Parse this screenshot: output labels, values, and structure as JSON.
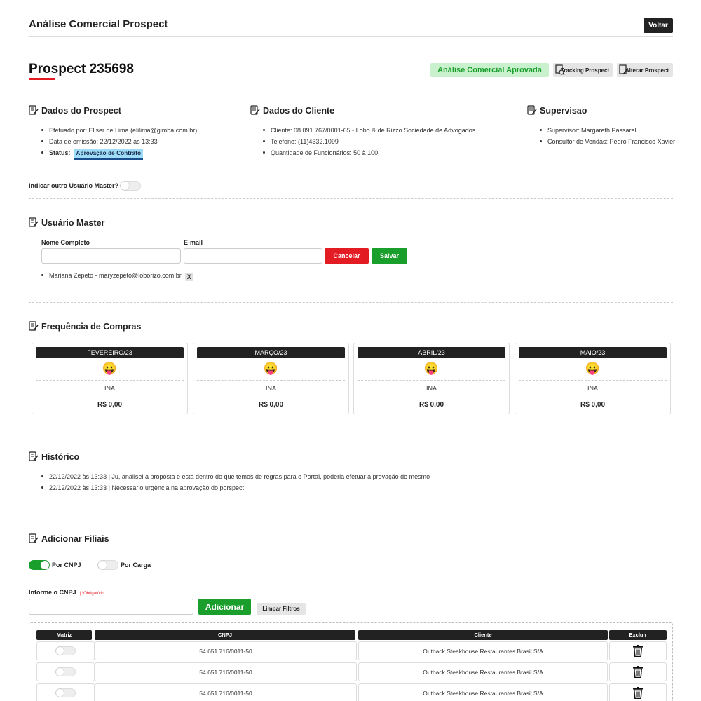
{
  "header": {
    "title": "Análise Comercial Prospect",
    "back_label": "Voltar"
  },
  "prospect": {
    "title": "Prospect 235698",
    "status_badge": "Análise Comercial Aprovada",
    "tracking_label": "Tracking Prospect",
    "alterar_label": "Alterar Prospect"
  },
  "dados_prospect": {
    "heading": "Dados do Prospect",
    "efetuado": "Efetuado por: Eliser de Lima (elilima@gimba.com.br)",
    "emissao": "Data de emissão: 22/12/2022 às 13:33",
    "status_label": "Status:",
    "status_value": "Aprovação de Contrato"
  },
  "dados_cliente": {
    "heading": "Dados do Cliente",
    "cliente": "Cliente: 08.091.767/0001-65 - Lobo & de Rizzo Sociedade de Advogados",
    "telefone": "Telefone: (11)4332.1099",
    "funcionarios": "Quantidade de Funcionários: 50 à 100"
  },
  "supervisao": {
    "heading": "Supervisao",
    "supervisor": "Supervisor: Margareth Passareli",
    "consultor": "Consultor de Vendas: Pedro Francisco Xavier"
  },
  "master_toggle_label": "Indicar outro Usuário Master?",
  "usuario_master": {
    "heading": "Usuário Master",
    "nome_label": "Nome Completo",
    "email_label": "E-mail",
    "nome_value": "",
    "email_value": "",
    "cancel_label": "Cancelar",
    "save_label": "Salvar",
    "entry": "Mariana Zepeto - maryzepeto@loborizo.com.br",
    "remove_label": "X"
  },
  "frequencia": {
    "heading": "Frequência de Compras",
    "months": [
      {
        "name": "FEVEREIRO/23",
        "emoji": "😛",
        "label": "INA",
        "value": "R$ 0,00"
      },
      {
        "name": "MARÇO/23",
        "emoji": "😛",
        "label": "INA",
        "value": "R$ 0,00"
      },
      {
        "name": "ABRIL/23",
        "emoji": "😛",
        "label": "INA",
        "value": "R$ 0,00"
      },
      {
        "name": "MAIO/23",
        "emoji": "😛",
        "label": "INA",
        "value": "R$ 0,00"
      }
    ]
  },
  "historico": {
    "heading": "Histórico",
    "items": [
      "22/12/2022 às 13:33 | Ju, analisei a proposta e esta dentro do que temos de regras para o Portal, poderia efetuar a provação do mesmo",
      "22/12/2022 às 13:33 | Necessário urgência na aprovação do porspect"
    ]
  },
  "filiais": {
    "heading": "Adicionar Filiais",
    "por_cnpj": "Por CNPJ",
    "por_carga": "Por Carga",
    "cnpj_label": "Informe o CNPJ",
    "required": "| *Obrigatório",
    "cnpj_value": "",
    "add_label": "Adicionar",
    "clear_label": "Limpar Filtros",
    "columns": [
      "Matriz",
      "CNPJ",
      "Cliente",
      "Excluir"
    ],
    "rows": [
      {
        "cnpj": "54.651.716/0011-50",
        "cliente": "Outback Steakhouse Restaurantes Brasil S/A"
      },
      {
        "cnpj": "54.651.716/0011-50",
        "cliente": "Outback Steakhouse Restaurantes Brasil S/A"
      },
      {
        "cnpj": "54.651.716/0011-50",
        "cliente": "Outback Steakhouse Restaurantes Brasil S/A"
      }
    ]
  },
  "colors": {
    "accent_red": "#e31b23",
    "green": "#1a9e2c",
    "dark": "#222222",
    "approved_bg": "#c9f1cd"
  }
}
